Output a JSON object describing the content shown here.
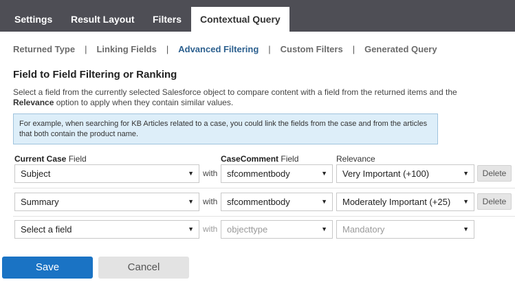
{
  "tabs": [
    {
      "label": "Settings"
    },
    {
      "label": "Result Layout"
    },
    {
      "label": "Filters"
    },
    {
      "label": "Contextual Query",
      "active": true
    }
  ],
  "subnav": [
    {
      "label": "Returned Type"
    },
    {
      "label": "Linking Fields"
    },
    {
      "label": "Advanced Filtering",
      "active": true
    },
    {
      "label": "Custom Filters"
    },
    {
      "label": "Generated Query"
    }
  ],
  "section": {
    "title": "Field to Field Filtering or Ranking",
    "desc_part1": "Select a field from the currently selected Salesforce object to compare content with a field from the returned items and the ",
    "desc_bold": "Relevance",
    "desc_part2": " option to apply when they contain similar values.",
    "info": "For example, when searching for KB Articles related to a case, you could link the fields from the case and from the articles that both contain the product name."
  },
  "columns": {
    "current_bold": "Current Case",
    "current_rest": " Field",
    "comment_bold": "CaseComment",
    "comment_rest": " Field",
    "relevance": "Relevance"
  },
  "rows": [
    {
      "field": "Subject",
      "with": "with",
      "comment_field": "sfcommentbody",
      "relevance": "Very Important (+100)",
      "delete": "Delete"
    },
    {
      "field": "Summary",
      "with": "with",
      "comment_field": "sfcommentbody",
      "relevance": "Moderately Important (+25)",
      "delete": "Delete"
    },
    {
      "field": "Select a field",
      "with": "with",
      "comment_field": "objecttype",
      "relevance": "Mandatory"
    }
  ],
  "buttons": {
    "save": "Save",
    "cancel": "Cancel"
  },
  "colors": {
    "tab_bar": "#4e4e55",
    "active_link": "#2b5f8e",
    "info_bg": "#ddeef9",
    "save_bg": "#1a73c4"
  }
}
